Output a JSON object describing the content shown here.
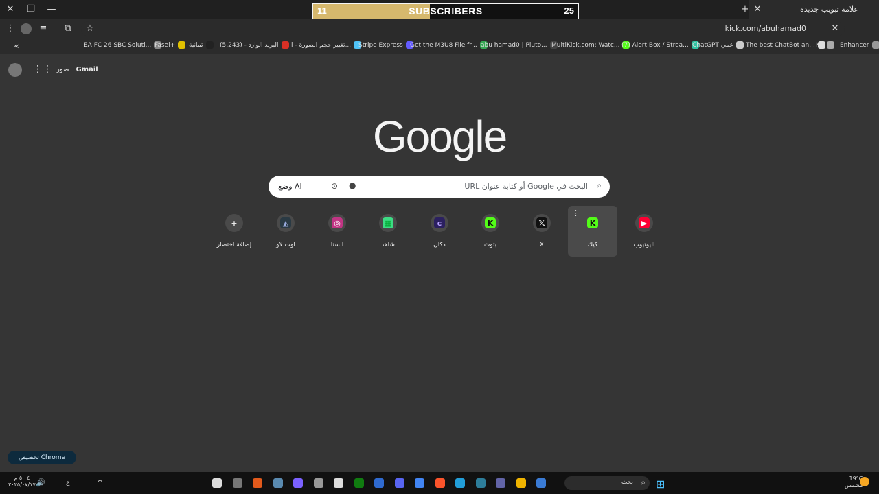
{
  "overlay": {
    "left_value": "11",
    "label": "SUBSCRIBERS",
    "right_value": "25",
    "progress": 0.44
  },
  "tab": {
    "title": "علامة تبويب جديدة"
  },
  "toolbar": {
    "url": "kick.com/abuhamad0"
  },
  "bookmarks": [
    {
      "label": "EA FC 26 SBC Soluti...",
      "color": "#888888"
    },
    {
      "label": "Fasel+",
      "color": "#e0c000"
    },
    {
      "label": "ثمانية",
      "color": "#222222"
    },
    {
      "label": "البريد الوارد - (5,243)",
      "color": "#d93025"
    },
    {
      "label": "تغيير حجم الصورة - ا...",
      "color": "#4fc3f7"
    },
    {
      "label": "Stripe Express",
      "color": "#635bff"
    },
    {
      "label": "Get the M3U8 File fr...",
      "color": "#34a853"
    },
    {
      "label": "abu hamad0 | Pluto...",
      "color": "#444444"
    },
    {
      "label": "MultiKick.com: Watc...",
      "color": "#53fc18"
    },
    {
      "label": "(7) Alert Box / Strea...",
      "color": "#31c3a2"
    },
    {
      "label": "ChatGPT عمي",
      "color": "#cccccc"
    },
    {
      "label": "The best ChatBot an...",
      "color": "#dddddd"
    },
    {
      "label": "KR",
      "color": "#aaaaaa"
    },
    {
      "label": "Enhancer",
      "color": "#999999"
    }
  ],
  "top_links": {
    "gmail": "Gmail",
    "images": "صور"
  },
  "logo": "Google",
  "search": {
    "placeholder": "البحث في Google أو كتابة عنوان URL",
    "ai_mode": "وضع AI"
  },
  "shortcuts": [
    {
      "label": "إضافة اختصار",
      "icon": "+",
      "color": "#e8e8e8",
      "bg": "#4a4a4a"
    },
    {
      "label": "اوت لاو",
      "icon": "◭",
      "color": "#9ad",
      "bg": "#2a3a44"
    },
    {
      "label": "انستا",
      "icon": "◎",
      "color": "#ffffff",
      "bg": "#c13584"
    },
    {
      "label": "شاهد",
      "icon": "▦",
      "color": "#0a3",
      "bg": "#3ddc84"
    },
    {
      "label": "دكان",
      "icon": "c",
      "color": "#b8a2ff",
      "bg": "#2b2060"
    },
    {
      "label": "بثوث",
      "icon": "K",
      "color": "#111",
      "bg": "#53fc18"
    },
    {
      "label": "X",
      "icon": "𝕏",
      "color": "#fff",
      "bg": "#111"
    },
    {
      "label": "كيك",
      "icon": "K",
      "color": "#111",
      "bg": "#53fc18"
    },
    {
      "label": "اليوتيوب",
      "icon": "▶",
      "color": "#fff",
      "bg": "#ff0033"
    }
  ],
  "customize": "تخصيص Chrome",
  "taskbar": {
    "search_label": "بحث",
    "weather_temp": "19°C",
    "weather_desc": "مشمس",
    "time": "٥:٠٤ م",
    "date": "٢٠٢٥/٠٧/١٧",
    "lang": "ع"
  }
}
